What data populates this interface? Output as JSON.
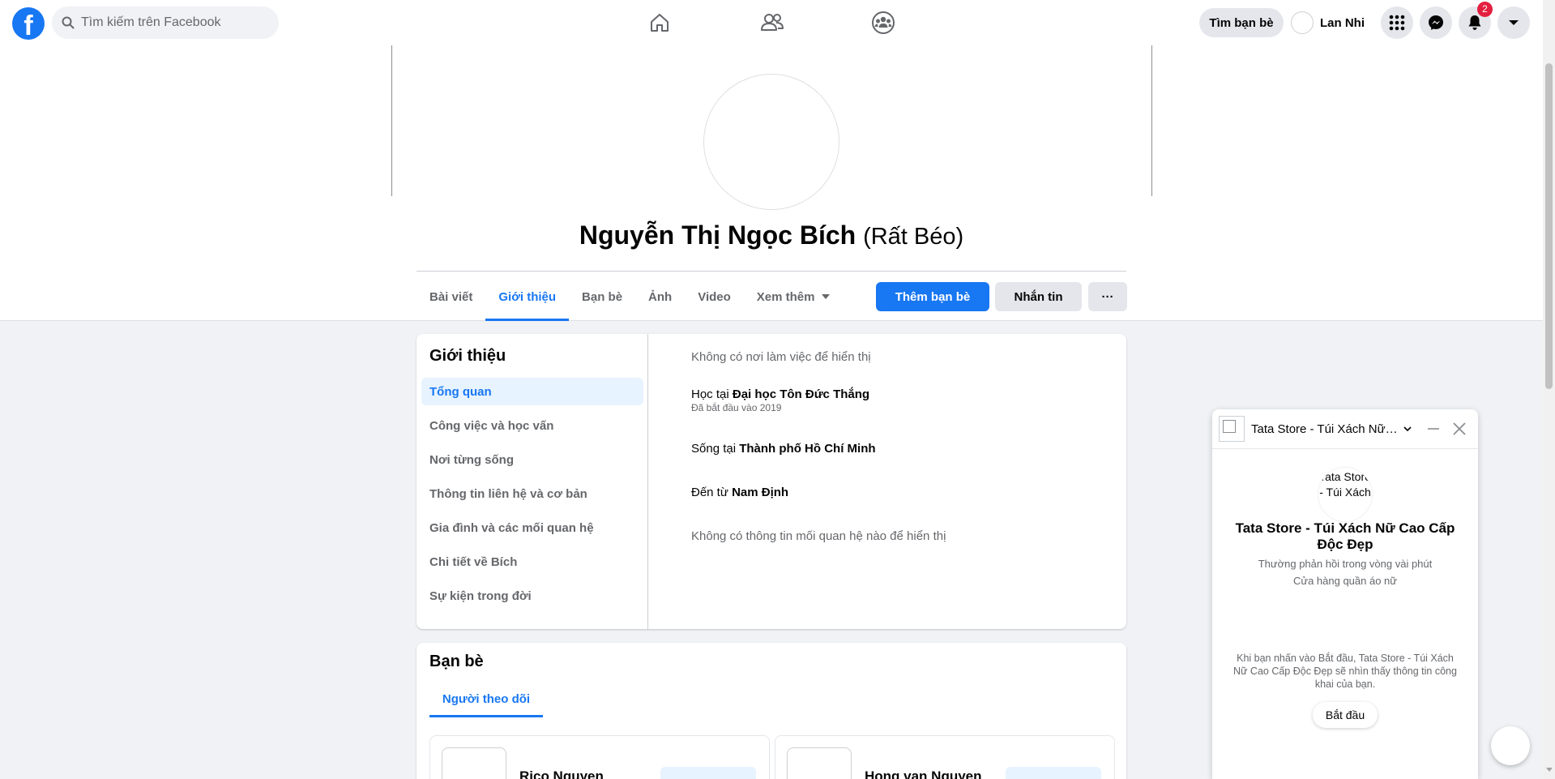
{
  "topbar": {
    "logo_letter": "f",
    "search_placeholder": "Tìm kiếm trên Facebook",
    "find_friends_label": "Tìm bạn bè",
    "user_name": "Lan Nhi",
    "notification_count": "2",
    "center_icons": [
      "home-icon",
      "friends-icon",
      "groups-icon"
    ],
    "accent_color": "#1877f2"
  },
  "profile": {
    "name": "Nguyễn Thị Ngọc Bích",
    "alternate_name": "(Rất Béo)",
    "tabs": [
      {
        "label": "Bài viết",
        "active": false
      },
      {
        "label": "Giới thiệu",
        "active": true
      },
      {
        "label": "Bạn bè",
        "active": false
      },
      {
        "label": "Ảnh",
        "active": false
      },
      {
        "label": "Video",
        "active": false
      },
      {
        "label": "Xem thêm",
        "active": false
      }
    ],
    "add_friend_label": "Thêm bạn bè",
    "message_label": "Nhắn tin",
    "more_label": "···"
  },
  "about": {
    "title": "Giới thiệu",
    "menu": [
      {
        "label": "Tổng quan",
        "active": true
      },
      {
        "label": "Công việc và học vấn",
        "active": false
      },
      {
        "label": "Nơi từng sống",
        "active": false
      },
      {
        "label": "Thông tin liên hệ và cơ bản",
        "active": false
      },
      {
        "label": "Gia đình và các mối quan hệ",
        "active": false
      },
      {
        "label": "Chi tiết về Bích",
        "active": false
      },
      {
        "label": "Sự kiện trong đời",
        "active": false
      }
    ],
    "no_work": "Không có nơi làm việc để hiển thị",
    "study_prefix": "Học tại",
    "study_place": "Đại học Tôn Đức Thắng",
    "study_started": "Đã bắt đầu vào 2019",
    "live_prefix": "Sống tại",
    "live_place": "Thành phố Hồ Chí Minh",
    "from_prefix": "Đến từ",
    "from_place": "Nam Định",
    "no_relationship": "Không có thông tin mối quan hệ nào để hiển thị"
  },
  "friends": {
    "title": "Bạn bè",
    "tab_label": "Người theo dõi",
    "items": [
      {
        "name": "Rico Nguyen"
      },
      {
        "name": "Hong van Nguyen"
      }
    ]
  },
  "chat": {
    "title": "Tata Store - Túi Xách Nữ Cao Cấp Độc Đẹp",
    "avatar_alt": "Tata Store - Túi Xách",
    "page_name": "Tata Store - Túi Xách Nữ Cao Cấp Độc Đẹp",
    "response_time": "Thường phản hồi trong vòng vài phút",
    "category": "Cửa hàng quần áo nữ",
    "consent_note": "Khi bạn nhấn vào Bắt đầu, Tata Store - Túi Xách Nữ Cao Cấp Độc Đẹp sẽ nhìn thấy thông tin công khai của bạn.",
    "start_label": "Bắt đầu"
  }
}
